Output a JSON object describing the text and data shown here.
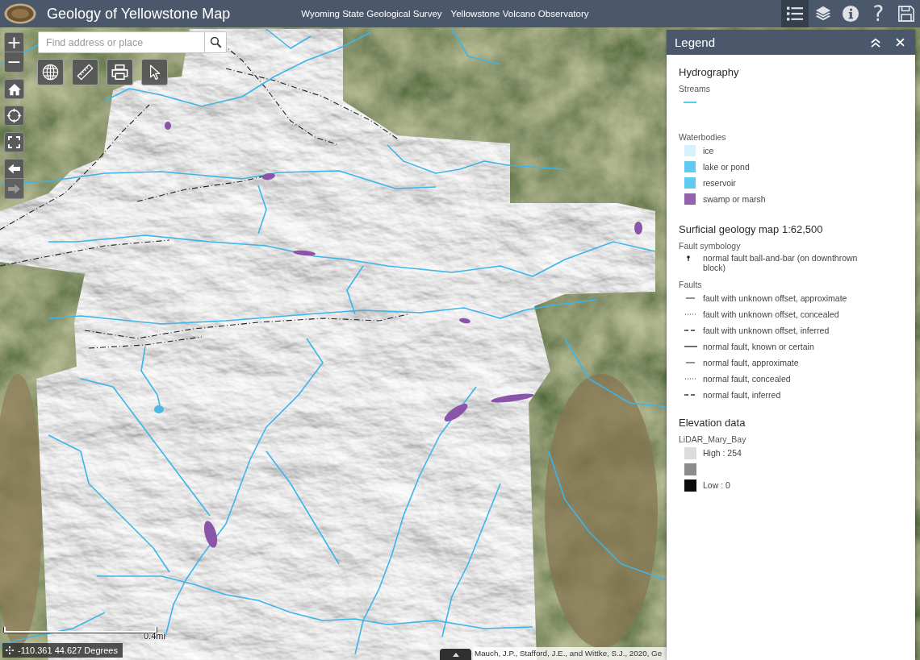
{
  "header": {
    "title": "Geology of Yellowstone Map",
    "links": [
      "Wyoming State Geological Survey",
      "Yellowstone Volcano Observatory"
    ],
    "tools": [
      {
        "kind": "legend",
        "selected": true
      },
      {
        "kind": "layers",
        "selected": false
      },
      {
        "kind": "about",
        "selected": false
      },
      {
        "kind": "help",
        "glyph": "?",
        "selected": false
      },
      {
        "kind": "save",
        "selected": false
      }
    ]
  },
  "map_controls": [
    {
      "buttons": [
        {
          "kind": "zoom-in",
          "label": "+"
        },
        {
          "kind": "zoom-out",
          "label": "−"
        }
      ]
    },
    {
      "buttons": [
        {
          "kind": "home"
        }
      ]
    },
    {
      "buttons": [
        {
          "kind": "locate"
        }
      ]
    },
    {
      "buttons": [
        {
          "kind": "fullscreen"
        }
      ]
    },
    {
      "buttons": [
        {
          "kind": "back",
          "disabled": false
        },
        {
          "kind": "forward",
          "disabled": true
        }
      ]
    }
  ],
  "search": {
    "placeholder": "Find address or place"
  },
  "tools": [
    {
      "kind": "basemap"
    },
    {
      "kind": "measure"
    },
    {
      "kind": "print"
    },
    {
      "kind": "select"
    }
  ],
  "legend": {
    "title": "Legend",
    "groups": [
      {
        "title": "Hydrography",
        "layers": [
          {
            "title": "Streams",
            "items": [
              {
                "kind": "line",
                "color": "#5bc8ef"
              }
            ]
          },
          {
            "title": "Waterbodies",
            "items": [
              {
                "kind": "fill",
                "label": "ice",
                "color": "#d7f1fc"
              },
              {
                "kind": "fill",
                "label": "lake or pond",
                "color": "#5fcbf1"
              },
              {
                "kind": "fill",
                "label": "reservoir",
                "color": "#5fcbf1"
              },
              {
                "kind": "fill",
                "label": "swamp or marsh",
                "color": "#9361ad"
              }
            ]
          }
        ]
      },
      {
        "title": "Surficial geology map 1:62,500",
        "layers": [
          {
            "title": "Fault symbology",
            "items": [
              {
                "kind": "ball-and-bar",
                "label": "normal fault ball-and-bar (on downthrown block)"
              }
            ]
          },
          {
            "title": "Faults",
            "items": [
              {
                "kind": "short",
                "label": "fault with unknown offset, approximate"
              },
              {
                "kind": "dotted",
                "label": "fault with unknown offset, concealed"
              },
              {
                "kind": "dashed",
                "label": "fault with unknown offset, inferred"
              },
              {
                "kind": "solid",
                "label": "normal fault, known or certain"
              },
              {
                "kind": "short",
                "label": "normal fault, approximate"
              },
              {
                "kind": "dotted",
                "label": "normal fault, concealed"
              },
              {
                "kind": "dashed",
                "label": "normal fault, inferred"
              }
            ]
          }
        ]
      },
      {
        "title": "Elevation data",
        "layers": [
          {
            "title": "LiDAR_Mary_Bay",
            "items": [
              {
                "kind": "ramp",
                "label": "High : 254",
                "color": "#dcdcdc"
              },
              {
                "kind": "ramp",
                "color": "#8c8c8c"
              },
              {
                "kind": "ramp",
                "label": "Low : 0",
                "color": "#0c0c0c"
              }
            ]
          }
        ]
      }
    ]
  },
  "scale_bar": {
    "label": "0.4mi"
  },
  "coordinates": "-110.361 44.627 Degrees",
  "attribution": {
    "text": "Mauch, J.P., Stafford, J.E., and Wittke, S.J., 2020, Ge",
    "expanded": false
  }
}
